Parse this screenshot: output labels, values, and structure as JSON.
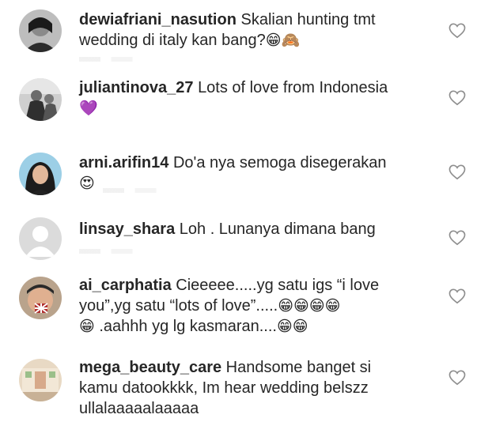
{
  "comments": [
    {
      "username": "dewiafriani_nasution",
      "text": "Skalian hunting tmt wedding di italy kan bang?",
      "emoji": "😁🙈"
    },
    {
      "username": "juliantinova_27",
      "text": "Lots of love from Indonesia",
      "emoji": "💜"
    },
    {
      "username": "arni.arifin14",
      "text": "Do'a nya semoga disegerakan",
      "emoji": "😍"
    },
    {
      "username": "linsay_shara",
      "text": "Loh . Lunanya dimana bang",
      "emoji": ""
    },
    {
      "username": "ai_carphatia",
      "text": "Cieeeee.....yg satu igs “i love you”,yg satu “lots of love”.....",
      "emoji": "😁😁😁😁",
      "text2": ".aahhh yg lg kasmaran....",
      "emoji2": "😁😁",
      "emoji_lead": "😁"
    },
    {
      "username": "mega_beauty_care",
      "text": "Handsome banget si kamu datookkkk,  Im hear wedding belszz ullalaaaaalaaaaa",
      "emoji": ""
    }
  ],
  "icons": {
    "like": "heart-outline-icon"
  },
  "colors": {
    "text": "#262626",
    "icon": "#8e8e8e"
  }
}
